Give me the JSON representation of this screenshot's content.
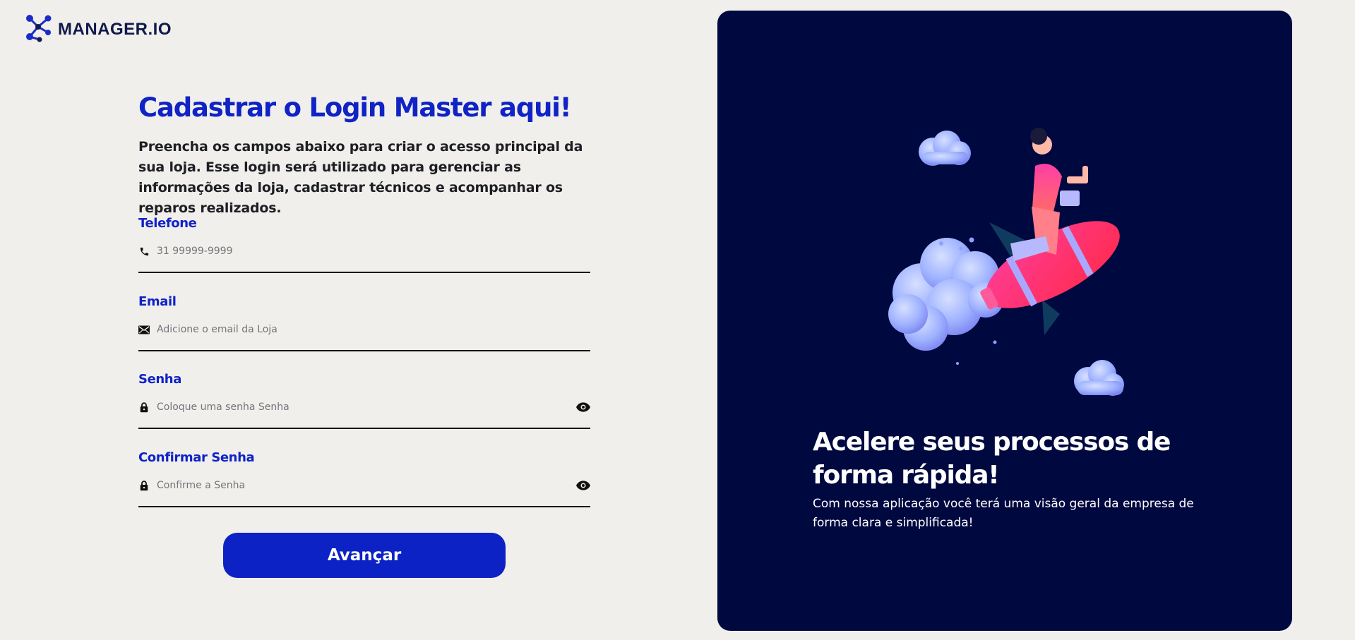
{
  "brand": {
    "name": "MANAGER.IO"
  },
  "form": {
    "title": "Cadastrar o Login Master aqui!",
    "description": "Preencha os campos abaixo para criar o acesso principal da sua loja. Esse login será utilizado para gerenciar as informações da loja, cadastrar técnicos e acompanhar os reparos realizados.",
    "fields": [
      {
        "label": "Telefone",
        "placeholder": "31 99999-9999",
        "value": "",
        "icon": "phone-icon"
      },
      {
        "label": "Email",
        "placeholder": "Adicione o email da Loja",
        "value": "",
        "icon": "mail-icon"
      },
      {
        "label": "Senha",
        "placeholder": "Coloque uma senha Senha",
        "value": "",
        "icon": "lock-icon",
        "toggle_icon": "eye-icon"
      },
      {
        "label": "Confirmar Senha",
        "placeholder": "Confirme a Senha",
        "value": "",
        "icon": "lock-icon",
        "toggle_icon": "eye-icon"
      }
    ],
    "submit_label": "Avançar"
  },
  "hero": {
    "title": "Acelere seus processos de forma rápida!",
    "subtitle": "Com nossa aplicação você terá uma visão geral da empresa de forma clara e simplificada!"
  },
  "colors": {
    "accent": "#0d22c5",
    "panel_bg": "#000840",
    "page_bg": "#f0efec"
  }
}
